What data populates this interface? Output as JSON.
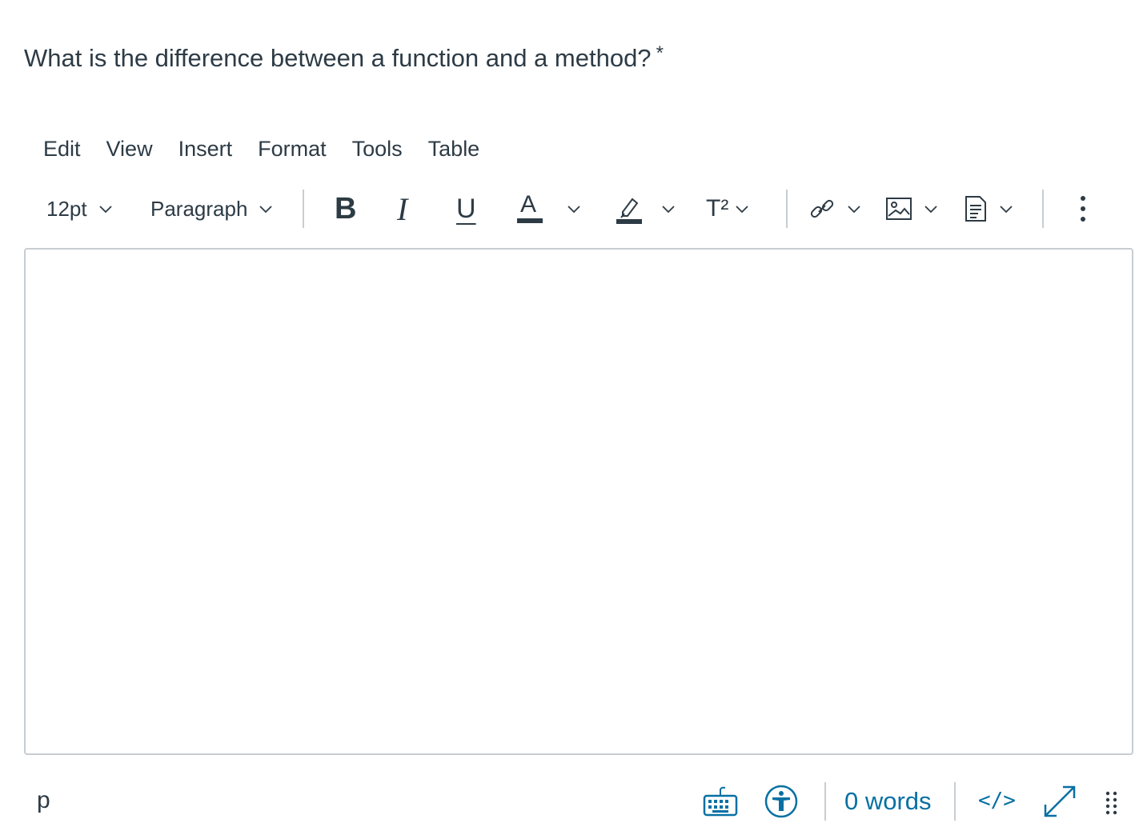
{
  "question": {
    "text": "What is the difference between a function and a method?",
    "required_mark": "*"
  },
  "menubar": {
    "items": [
      "Edit",
      "View",
      "Insert",
      "Format",
      "Tools",
      "Table"
    ]
  },
  "toolbar": {
    "font_size": "12pt",
    "block_format": "Paragraph",
    "bold_glyph": "B",
    "italic_glyph": "I",
    "underline_glyph": "U",
    "text_color_glyph": "A",
    "superscript_glyph": "T²"
  },
  "editor": {
    "content": ""
  },
  "statusbar": {
    "element_path": "p",
    "word_count": "0 words",
    "html_toggle": "</>"
  },
  "colors": {
    "text": "#2d3b45",
    "link": "#0770a3",
    "border": "#c7cdd1"
  }
}
